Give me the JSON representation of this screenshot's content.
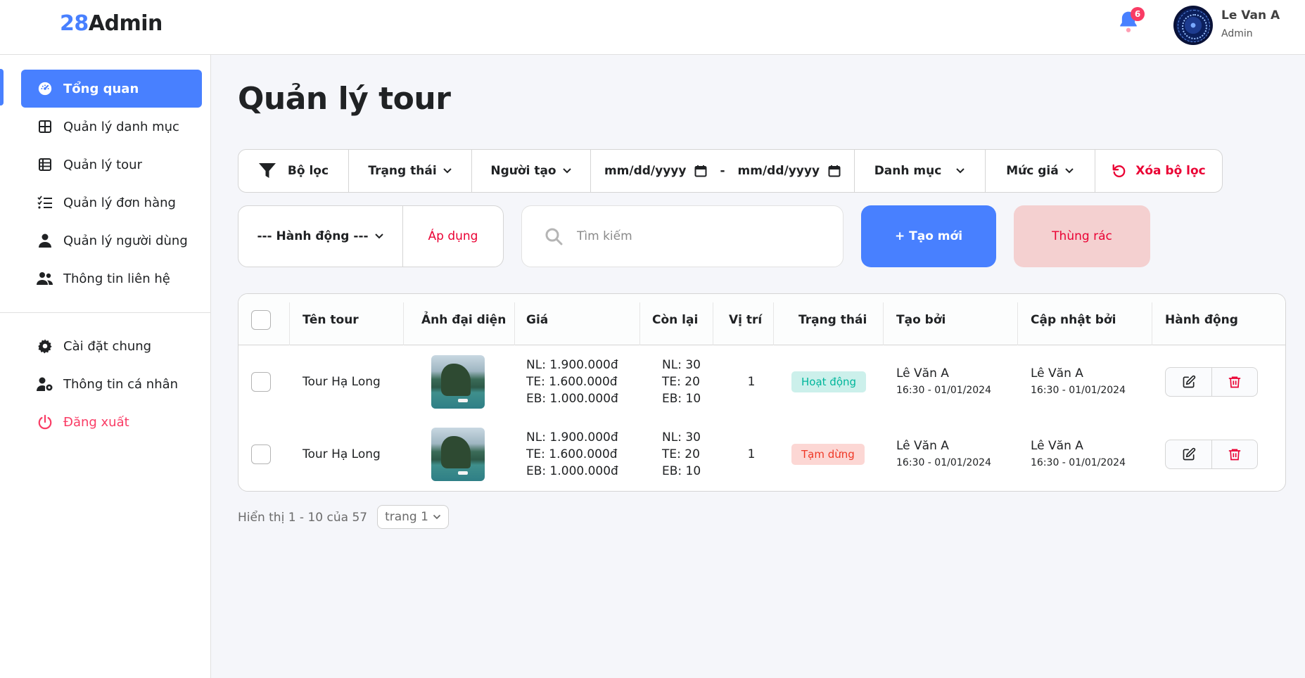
{
  "header": {
    "logo_accent": "28",
    "logo_text": "Admin",
    "notification_count": "6",
    "user_name": "Le Van A",
    "user_role": "Admin"
  },
  "sidebar": {
    "items": [
      {
        "label": "Tổng quan",
        "icon": "dashboard-icon",
        "active": true
      },
      {
        "label": "Quản lý danh mục",
        "icon": "grid-icon"
      },
      {
        "label": "Quản lý tour",
        "icon": "table-icon"
      },
      {
        "label": "Quản lý đơn hàng",
        "icon": "checklist-icon"
      },
      {
        "label": "Quản lý người dùng",
        "icon": "user-icon"
      },
      {
        "label": "Thông tin liên hệ",
        "icon": "users-icon"
      }
    ],
    "bottom_items": [
      {
        "label": "Cài đặt chung",
        "icon": "gear-icon"
      },
      {
        "label": "Thông tin cá nhân",
        "icon": "user-cog-icon"
      },
      {
        "label": "Đăng xuất",
        "icon": "power-icon"
      }
    ]
  },
  "page": {
    "title": "Quản lý tour"
  },
  "filters": {
    "filter_label": "Bộ lọc",
    "status": "Trạng thái",
    "creator": "Người tạo",
    "date_from": "mm/dd/yyyy",
    "date_sep": "-",
    "date_to": "mm/dd/yyyy",
    "category": "Danh mục",
    "price": "Mức giá",
    "clear": "Xóa bộ lọc"
  },
  "actions": {
    "select_label": "--- Hành động ---",
    "apply": "Áp dụng",
    "search_placeholder": "Tìm kiếm",
    "create": "+ Tạo mới",
    "trash": "Thùng rác"
  },
  "table": {
    "headers": [
      "Tên tour",
      "Ảnh đại diện",
      "Giá",
      "Còn lại",
      "Vị trí",
      "Trạng thái",
      "Tạo bởi",
      "Cập nhật bởi",
      "Hành động"
    ],
    "rows": [
      {
        "name": "Tour Hạ Long",
        "price": [
          "NL: 1.900.000đ",
          "TE: 1.600.000đ",
          "EB: 1.000.000đ"
        ],
        "stock": [
          "NL: 30",
          "TE: 20",
          "EB: 10"
        ],
        "position": "1",
        "status": "Hoạt động",
        "status_type": "active",
        "created_by": "Lê Văn A",
        "created_at": "16:30 - 01/01/2024",
        "updated_by": "Lê Văn A",
        "updated_at": "16:30 - 01/01/2024"
      },
      {
        "name": "Tour Hạ Long",
        "price": [
          "NL: 1.900.000đ",
          "TE: 1.600.000đ",
          "EB: 1.000.000đ"
        ],
        "stock": [
          "NL: 30",
          "TE: 20",
          "EB: 10"
        ],
        "position": "1",
        "status": "Tạm dừng",
        "status_type": "paused",
        "created_by": "Lê Văn A",
        "created_at": "16:30 - 01/01/2024",
        "updated_by": "Lê Văn A",
        "updated_at": "16:30 - 01/01/2024"
      }
    ]
  },
  "pagination": {
    "info": "Hiển thị 1 - 10 của 57",
    "page_select": "trang 1"
  },
  "colors": {
    "accent": "#4880ff",
    "danger": "#ea0234",
    "active_bg": "#ccf0eb",
    "active_text": "#00b69b",
    "paused_bg": "#fcd7d4",
    "paused_text": "#ef3826"
  }
}
